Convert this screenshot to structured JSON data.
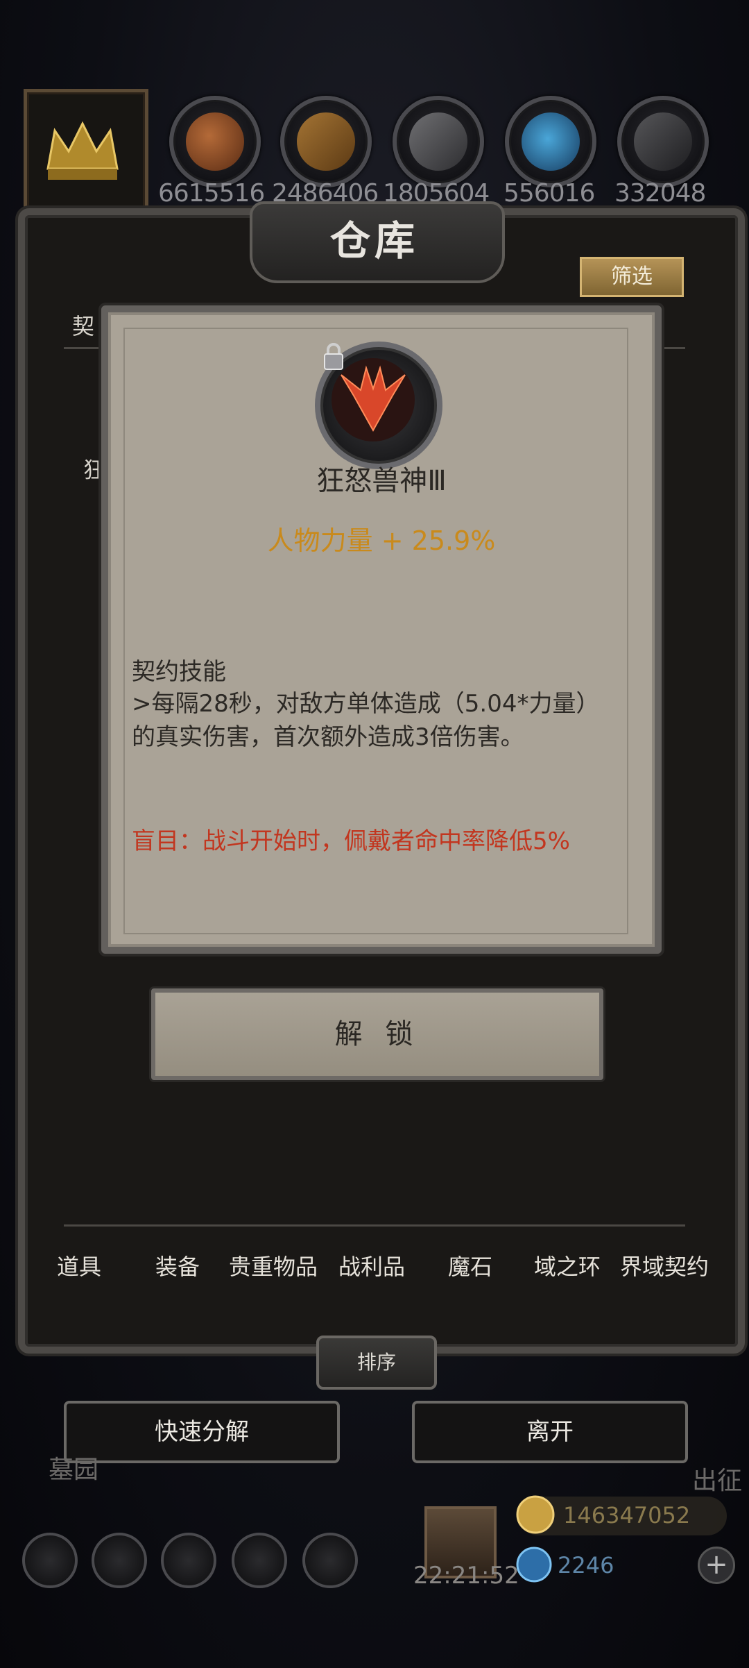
{
  "resources": [
    {
      "icon": "meat-icon",
      "count": "6615516"
    },
    {
      "icon": "wood-icon",
      "count": "2486406"
    },
    {
      "icon": "stone-icon",
      "count": "1805604"
    },
    {
      "icon": "crystal-icon",
      "count": "556016"
    },
    {
      "icon": "iron-icon",
      "count": "332048"
    }
  ],
  "panel": {
    "title": "仓库",
    "filter_label": "筛选",
    "sub_tab_hint": "契",
    "side_hint": "狂"
  },
  "tooltip": {
    "skill_name": "狂怒兽神Ⅲ",
    "stat": "人物力量 + 25.9%",
    "desc_head": "契约技能",
    "desc_body": ">每隔28秒，对敌方单体造成（5.04*力量）的真实伤害，首次额外造成3倍伤害。",
    "debuff": "盲目：战斗开始时，佩戴者命中率降低5%"
  },
  "unlock_label": "解 锁",
  "tabs": [
    "道具",
    "装备",
    "贵重物品",
    "战利品",
    "魔石",
    "域之环",
    "界域契约"
  ],
  "sort_label": "排序",
  "actions": {
    "quick_dismantle": "快速分解",
    "leave": "离开"
  },
  "hud": {
    "left_label": "墓园",
    "right_label": "出征",
    "clock": "22:21:52",
    "gold": "146347052",
    "gems": "2246"
  },
  "colors": {
    "stat": "#c98a1c",
    "debuff": "#c2361f",
    "filter_button": "#a8874b"
  }
}
